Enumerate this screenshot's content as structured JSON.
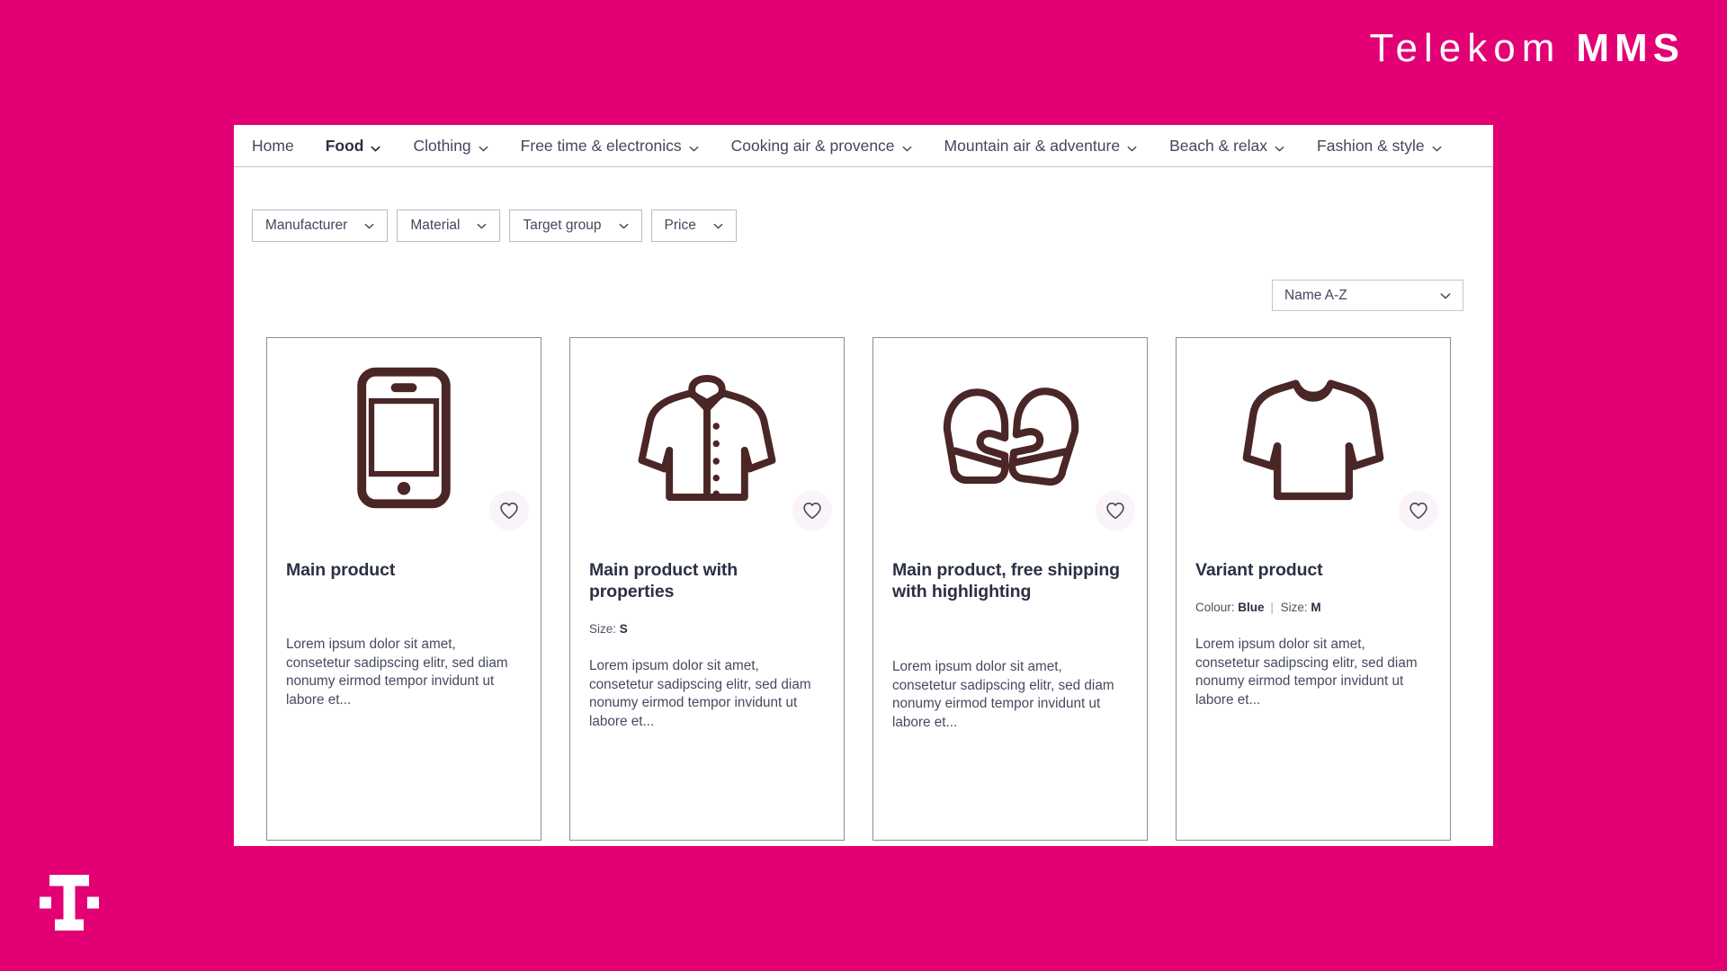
{
  "brand": {
    "word": "Telekom",
    "mms": "MMS",
    "logo_mark": "telekom-t-logo",
    "magenta": "#e20074"
  },
  "nav": {
    "items": [
      {
        "label": "Home",
        "has_caret": false,
        "active": false
      },
      {
        "label": "Food",
        "has_caret": true,
        "active": true
      },
      {
        "label": "Clothing",
        "has_caret": true,
        "active": false
      },
      {
        "label": "Free time & electronics",
        "has_caret": true,
        "active": false
      },
      {
        "label": "Cooking air & provence",
        "has_caret": true,
        "active": false
      },
      {
        "label": "Mountain air & adventure",
        "has_caret": true,
        "active": false
      },
      {
        "label": "Beach & relax",
        "has_caret": true,
        "active": false
      },
      {
        "label": "Fashion & style",
        "has_caret": true,
        "active": false
      }
    ]
  },
  "filters": [
    {
      "label": "Manufacturer",
      "icon": "chevron-down-icon"
    },
    {
      "label": "Material",
      "icon": "chevron-down-icon"
    },
    {
      "label": "Target group",
      "icon": "chevron-down-icon"
    },
    {
      "label": "Price",
      "icon": "chevron-down-icon"
    }
  ],
  "sort": {
    "value": "Name A-Z",
    "icon": "chevron-down-icon"
  },
  "products": [
    {
      "title": "Main product",
      "icon": "smartphone-icon",
      "properties": "",
      "description": "Lorem ipsum dolor sit amet, consetetur sadipscing elitr, sed diam nonumy eirmod tempor invidunt ut labore et...",
      "favourite_icon": "heart-icon"
    },
    {
      "title": "Main product with properties",
      "icon": "jacket-icon",
      "properties_label_1": "Size:",
      "properties_value_1": "S",
      "description": "Lorem ipsum dolor sit amet, consetetur sadipscing elitr, sed diam nonumy eirmod tempor invidunt ut labore et...",
      "favourite_icon": "heart-icon"
    },
    {
      "title": "Main product, free shipping with highlighting",
      "icon": "mittens-icon",
      "properties": "",
      "description": "Lorem ipsum dolor sit amet, consetetur sadipscing elitr, sed diam nonumy eirmod tempor invidunt ut labore et...",
      "favourite_icon": "heart-icon"
    },
    {
      "title": "Variant product",
      "icon": "sweater-icon",
      "properties_label_1": "Colour:",
      "properties_value_1": "Blue",
      "properties_sep": "|",
      "properties_label_2": "Size:",
      "properties_value_2": "M",
      "description": "Lorem ipsum dolor sit amet, consetetur sadipscing elitr, sed diam nonumy eirmod tempor invidunt ut labore et...",
      "favourite_icon": "heart-icon"
    }
  ]
}
